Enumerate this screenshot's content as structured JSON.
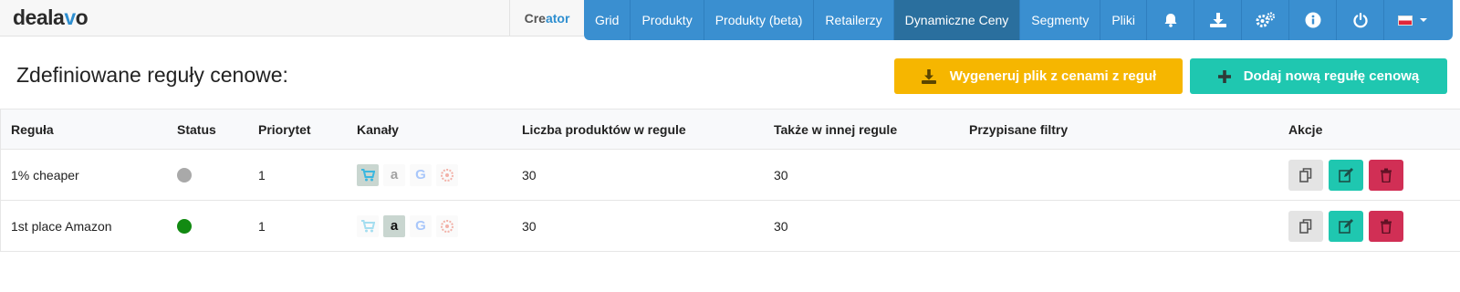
{
  "brand": {
    "logo_prefix": "deala",
    "logo_v": "v",
    "logo_suffix": "o"
  },
  "creator": {
    "part1": "Cre",
    "part2": "ator"
  },
  "nav": {
    "items": [
      {
        "label": "Grid",
        "active": false
      },
      {
        "label": "Produkty",
        "active": false
      },
      {
        "label": "Produkty (beta)",
        "active": false
      },
      {
        "label": "Retailerzy",
        "active": false
      },
      {
        "label": "Dynamiczne Ceny",
        "active": true
      },
      {
        "label": "Segmenty",
        "active": false
      },
      {
        "label": "Pliki",
        "active": false
      }
    ],
    "icons": [
      "bell-icon",
      "download-icon",
      "settings-icon",
      "info-icon",
      "power-icon"
    ],
    "language_flag": "pl"
  },
  "page": {
    "title": "Zdefiniowane reguły cenowe:",
    "generate_button": "Wygeneruj plik z cenami z reguł",
    "add_button": "Dodaj nową regułę cenową"
  },
  "table": {
    "headers": [
      "Reguła",
      "Status",
      "Priorytet",
      "Kanały",
      "Liczba produktów w regule",
      "Także w innej regule",
      "Przypisane filtry",
      "Akcje"
    ],
    "rows": [
      {
        "rule": "1% cheaper",
        "status": "inactive",
        "status_color": "#a9a9a9",
        "priority": "1",
        "channels_active": [
          "cart"
        ],
        "count": "30",
        "also": "30",
        "filters": ""
      },
      {
        "rule": "1st place Amazon",
        "status": "active",
        "status_color": "#128a12",
        "priority": "1",
        "channels_active": [
          "amazon"
        ],
        "count": "30",
        "also": "30",
        "filters": ""
      }
    ]
  },
  "colors": {
    "nav_blue": "#3a8fd0",
    "nav_active": "#2a6f9e",
    "generate_yellow": "#f6b600",
    "add_teal": "#1fc7b0",
    "delete_red": "#d12f55"
  }
}
